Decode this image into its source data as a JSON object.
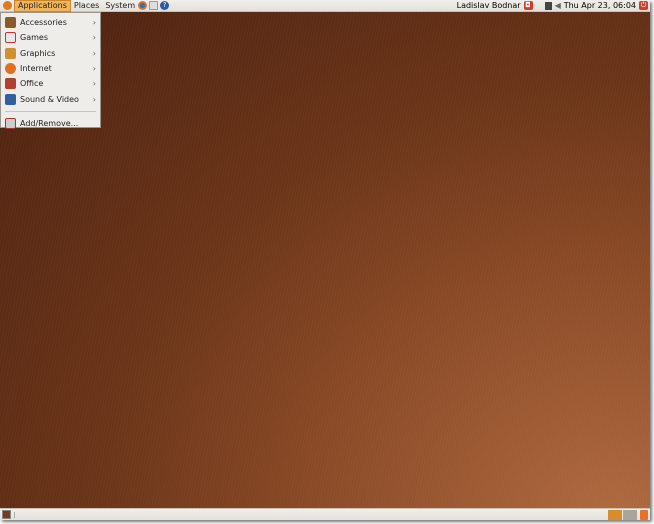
{
  "top_panel": {
    "menus": [
      "Applications",
      "Places",
      "System"
    ],
    "user": "Ladislav Bodnar",
    "clock": "Thu Apr 23, 06:04"
  },
  "app_menu": {
    "items": [
      {
        "label": "Accessories",
        "icon": "accessories-icon",
        "color": "#8a5a2a"
      },
      {
        "label": "Games",
        "icon": "games-icon",
        "color": "#c33"
      },
      {
        "label": "Graphics",
        "icon": "graphics-icon",
        "color": "#d09030"
      },
      {
        "label": "Internet",
        "icon": "internet-icon",
        "color": "#e07020"
      },
      {
        "label": "Office",
        "icon": "office-icon",
        "color": "#b04030"
      },
      {
        "label": "Sound & Video",
        "icon": "sound-video-icon",
        "color": "#3060a0"
      }
    ],
    "add_remove": "Add/Remove..."
  },
  "bottom_panel": {
    "workspaces": 2,
    "active_workspace": 1
  }
}
